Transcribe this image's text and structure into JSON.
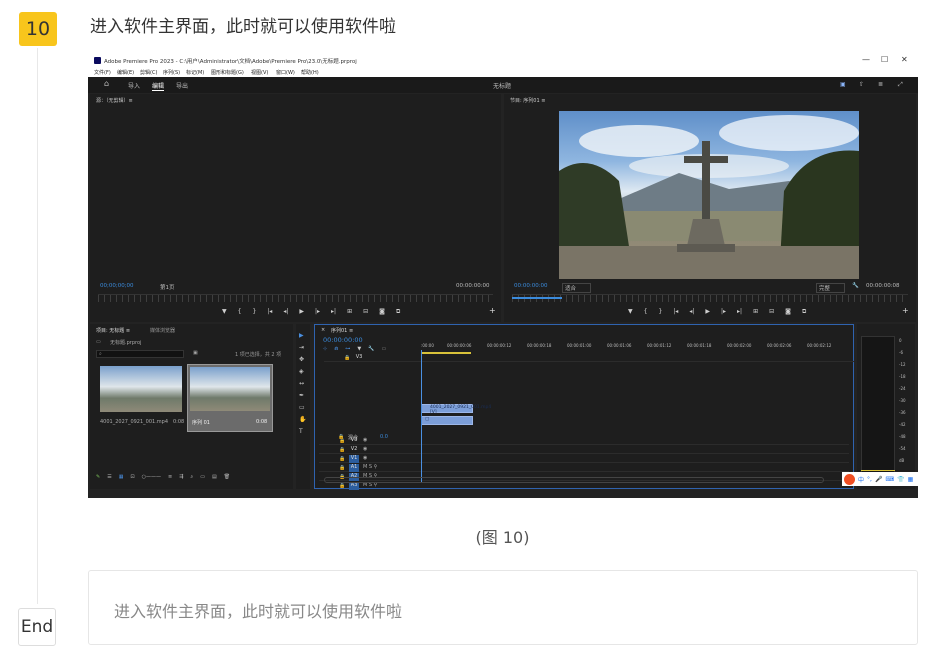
{
  "step": {
    "number": "10",
    "title": "进入软件主界面，此时就可以使用软件啦"
  },
  "caption": "(图 10)",
  "end_label": "End",
  "summary": "进入软件主界面，此时就可以使用软件啦",
  "screenshot": {
    "window_title": "Adobe Premiere Pro 2023 - C:\\用户\\Administrator\\文档\\Adobe\\Premiere Pro\\23.0\\无标题.prproj",
    "window_controls": [
      "—",
      "☐",
      "✕"
    ],
    "menu": [
      "文件(F)",
      "编辑(E)",
      "剪辑(C)",
      "序列(S)",
      "标记(M)",
      "图形和标题(G)",
      "视图(V)",
      "窗口(W)",
      "帮助(H)"
    ],
    "workspace_tabs": [
      "导入",
      "编辑",
      "导出"
    ],
    "center_title": "无标题",
    "source_panel": {
      "label": "源：（无剪辑）≡",
      "timecode_left": "00;00;00;00",
      "page": "第1页",
      "timecode_right": "00:00:00:00"
    },
    "program_panel": {
      "label": "节目: 序列01 ≡",
      "timecode_left": "00:00:00:00",
      "fit": "适合",
      "quality": "完整",
      "timecode_right": "00:00:00:08"
    },
    "project_panel": {
      "tabs": [
        "项目: 无标题 ≡",
        "媒体浏览器"
      ],
      "file": "无标题.prproj",
      "selection": "1 项已选择，共 2 项",
      "items": [
        {
          "name": "4001_2027_0921_001.mp4",
          "duration": "0:08"
        },
        {
          "name": "序列 01",
          "duration": "0:08"
        }
      ]
    },
    "sequence_panel": {
      "tab": "序列01 ≡",
      "timecode": "00:00:00:00",
      "ruler": [
        ":00:00",
        "00:00:00:06",
        "00:00:00:12",
        "00:00:00:18",
        "00:00:01:00",
        "00:00:01:06",
        "00:00:01:12",
        "00:00:01:18",
        "00:00:02:00",
        "00:00:02:06",
        "00:00:02:12"
      ],
      "video_tracks": [
        "V3",
        "V2",
        "V1"
      ],
      "audio_tracks": [
        "A1",
        "A2",
        "A3"
      ],
      "mix_label": "混合",
      "mix_value": "0.0",
      "clip_label": "4001_2027_0921_001.mp4 [V]"
    },
    "meter_scale": [
      "0",
      "-6",
      "-12",
      "-18",
      "-24",
      "-30",
      "-36",
      "-42",
      "-48",
      "-54",
      "dB"
    ],
    "ime_label": "中"
  }
}
